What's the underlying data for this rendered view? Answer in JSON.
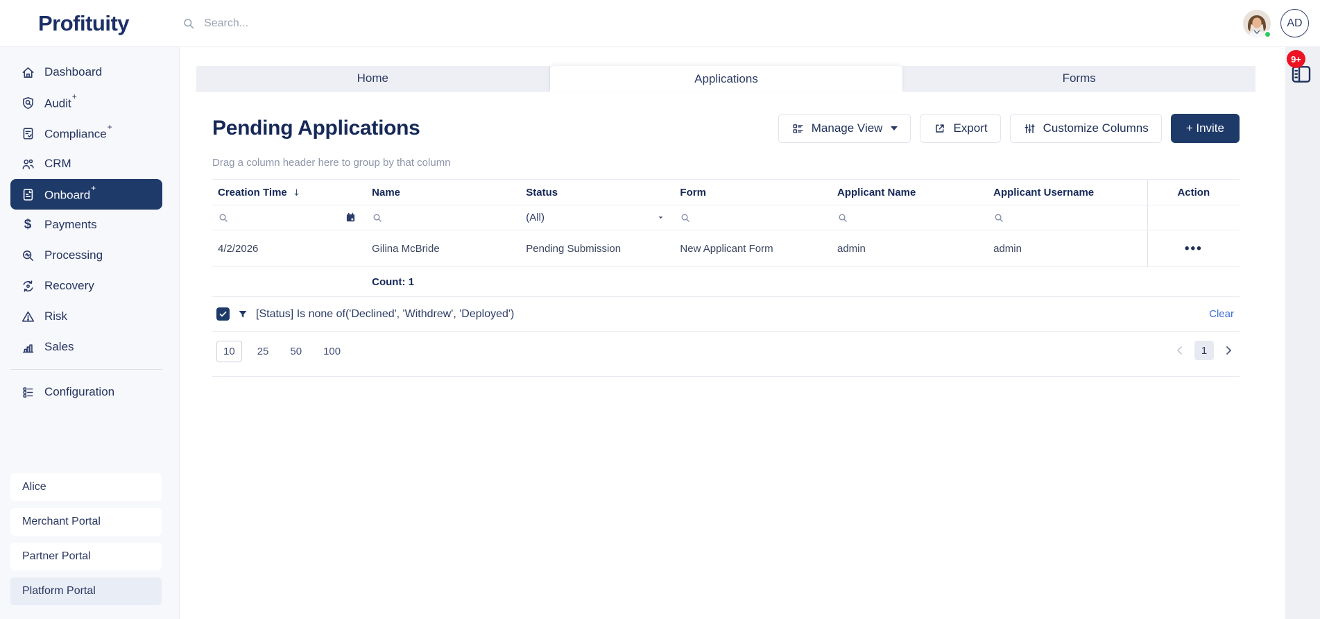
{
  "topbar": {
    "logo": "Profituity",
    "search_placeholder": "Search...",
    "avatar_initials": "AD"
  },
  "right_rail": {
    "notification_badge": "9+"
  },
  "sidebar": {
    "items": [
      {
        "label": "Dashboard"
      },
      {
        "label": "Audit",
        "plus": "+"
      },
      {
        "label": "Compliance",
        "plus": "+"
      },
      {
        "label": "CRM"
      },
      {
        "label": "Onboard",
        "plus": "+",
        "active": true
      },
      {
        "label": "Payments"
      },
      {
        "label": "Processing"
      },
      {
        "label": "Recovery"
      },
      {
        "label": "Risk"
      },
      {
        "label": "Sales"
      },
      {
        "label": "Configuration"
      }
    ],
    "portals": [
      {
        "label": "Alice"
      },
      {
        "label": "Merchant Portal"
      },
      {
        "label": "Partner Portal"
      },
      {
        "label": "Platform Portal"
      }
    ]
  },
  "tabs": [
    {
      "label": "Home"
    },
    {
      "label": "Applications",
      "active": true
    },
    {
      "label": "Forms"
    }
  ],
  "page": {
    "title": "Pending Applications",
    "toolbar": {
      "manage_view": "Manage View",
      "export": "Export",
      "customize_columns": "Customize Columns",
      "invite": "+ Invite"
    },
    "group_hint": "Drag a column header here to group by that column"
  },
  "grid": {
    "columns": [
      {
        "label": "Creation Time",
        "sorted": "desc"
      },
      {
        "label": "Name"
      },
      {
        "label": "Status"
      },
      {
        "label": "Form"
      },
      {
        "label": "Applicant Name"
      },
      {
        "label": "Applicant Username"
      },
      {
        "label": "Action"
      }
    ],
    "filters": {
      "status_value": "(All)"
    },
    "rows": [
      {
        "creation_time": "4/2/2026",
        "name": "Gilina McBride",
        "status": "Pending Submission",
        "form": "New Applicant Form",
        "applicant_name": "admin",
        "applicant_username": "admin",
        "action": "•••"
      }
    ],
    "summary": {
      "count": "Count: 1"
    },
    "filter_bar": {
      "text": "[Status] Is none of('Declined', 'Withdrew', 'Deployed')",
      "clear": "Clear"
    },
    "pagination": {
      "sizes": [
        "10",
        "25",
        "50",
        "100"
      ],
      "active_size": "10",
      "page": "1"
    }
  },
  "colors": {
    "primary_navy": "#1e3a69",
    "badge_red": "#ec1423",
    "online_green": "#2ecc5f",
    "link_blue": "#3f6cd9"
  }
}
